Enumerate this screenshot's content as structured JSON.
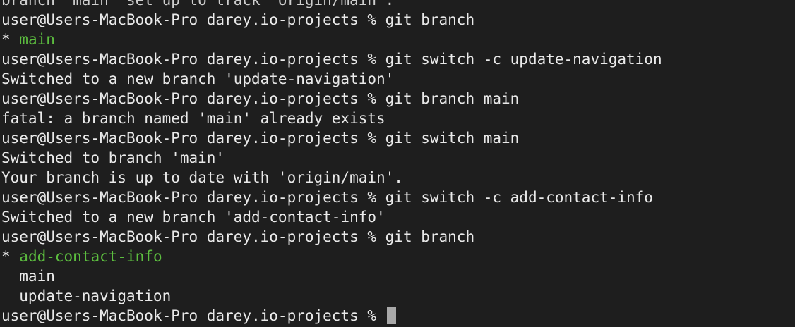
{
  "terminal": {
    "partial_line": "branch 'main' set up to track 'origin/main'.",
    "prompt": "user@Users-MacBook-Pro darey.io-projects % ",
    "cmd_branch_1": "git branch",
    "current_marker": "* ",
    "branch_main_current": "main",
    "cmd_switch_create_nav": "git switch -c update-navigation",
    "out_switched_nav": "Switched to a new branch 'update-navigation'",
    "cmd_branch_main": "git branch main",
    "out_fatal": "fatal: a branch named 'main' already exists",
    "cmd_switch_main": "git switch main",
    "out_switched_main": "Switched to branch 'main'",
    "out_up_to_date": "Your branch is up to date with 'origin/main'.",
    "cmd_switch_create_contact": "git switch -c add-contact-info",
    "out_switched_contact": "Switched to a new branch 'add-contact-info'",
    "cmd_branch_2": "git branch",
    "branch_contact_current": "add-contact-info",
    "branch_main_other": "  main",
    "branch_nav_other": "  update-navigation"
  },
  "colors": {
    "background": "#1e1e1e",
    "text": "#eaeaea",
    "current_branch": "#5cbd3f",
    "cursor": "#a9a9a9"
  }
}
